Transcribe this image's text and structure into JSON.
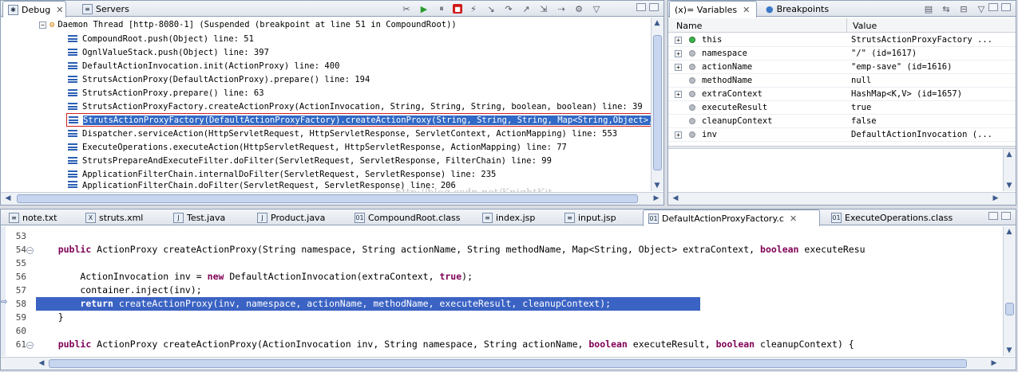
{
  "debug_panel": {
    "tabs": [
      {
        "label": "Debug",
        "active": true
      },
      {
        "label": "Servers",
        "active": false
      }
    ],
    "thread": "Daemon Thread [http-8080-1] (Suspended (breakpoint at line 51 in CompoundRoot))",
    "frames": [
      "CompoundRoot.push(Object) line: 51",
      "OgnlValueStack.push(Object) line: 397",
      "DefaultActionInvocation.init(ActionProxy) line: 400",
      "StrutsActionProxy(DefaultActionProxy).prepare() line: 194",
      "StrutsActionProxy.prepare() line: 63",
      "StrutsActionProxyFactory.createActionProxy(ActionInvocation, String, String, String, boolean, boolean) line: 39",
      "StrutsActionProxyFactory(DefaultActionProxyFactory).createActionProxy(String, String, String, Map<String,Object>, bool",
      "Dispatcher.serviceAction(HttpServletRequest, HttpServletResponse, ServletContext, ActionMapping) line: 553",
      "ExecuteOperations.executeAction(HttpServletRequest, HttpServletResponse, ActionMapping) line: 77",
      "StrutsPrepareAndExecuteFilter.doFilter(ServletRequest, ServletResponse, FilterChain) line: 99",
      "ApplicationFilterChain.internalDoFilter(ServletRequest, ServletResponse) line: 235",
      "ApplicationFilterChain.doFilter(ServletRequest, ServletResponse) line: 206"
    ],
    "selected_frame_index": 6,
    "watermark": "http://blog.csdn.net/KnightKit"
  },
  "variables_panel": {
    "tabs": [
      {
        "label": "(x)= Variables",
        "active": true
      },
      {
        "label": "Breakpoints",
        "active": false
      }
    ],
    "columns": [
      "Name",
      "Value"
    ],
    "rows": [
      {
        "expand": "+",
        "dot": "green",
        "name": "this",
        "value": "StrutsActionProxyFactory  ..."
      },
      {
        "expand": "+",
        "dot": "grey",
        "name": "namespace",
        "value": "\"/\" (id=1617)"
      },
      {
        "expand": "+",
        "dot": "grey",
        "name": "actionName",
        "value": "\"emp-save\" (id=1616)"
      },
      {
        "expand": "",
        "dot": "grey",
        "name": "methodName",
        "value": "null"
      },
      {
        "expand": "+",
        "dot": "grey",
        "name": "extraContext",
        "value": "HashMap<K,V>  (id=1657)"
      },
      {
        "expand": "",
        "dot": "grey",
        "name": "executeResult",
        "value": "true"
      },
      {
        "expand": "",
        "dot": "grey",
        "name": "cleanupContext",
        "value": "false"
      },
      {
        "expand": "+",
        "dot": "grey",
        "name": "inv",
        "value": "DefaultActionInvocation  (..."
      }
    ]
  },
  "editor": {
    "tabs": [
      {
        "label": "note.txt",
        "icon": "txt",
        "active": false
      },
      {
        "label": "struts.xml",
        "icon": "X",
        "active": false
      },
      {
        "label": "Test.java",
        "icon": "J",
        "active": false
      },
      {
        "label": "Product.java",
        "icon": "J",
        "active": false
      },
      {
        "label": "CompoundRoot.class",
        "icon": "010",
        "active": false
      },
      {
        "label": "index.jsp",
        "icon": "jsp",
        "active": false
      },
      {
        "label": "input.jsp",
        "icon": "jsp",
        "active": false
      },
      {
        "label": "DefaultActionProxyFactory.c",
        "icon": "010",
        "active": true
      },
      {
        "label": "ExecuteOperations.class",
        "icon": "010",
        "active": false
      }
    ],
    "lines": [
      {
        "num": "53",
        "code": ""
      },
      {
        "num": "54",
        "code": "    public ActionProxy createActionProxy(String namespace, String actionName, String methodName, Map<String, Object> extraContext, boolean executeResu",
        "kw": [
          "public",
          "boolean"
        ]
      },
      {
        "num": "55",
        "code": ""
      },
      {
        "num": "56",
        "code": "        ActionInvocation inv = new DefaultActionInvocation(extraContext, true);",
        "kw": [
          "new",
          "true"
        ]
      },
      {
        "num": "57",
        "code": "        container.inject(inv);"
      },
      {
        "num": "58",
        "code": "        return createActionProxy(inv, namespace, actionName, methodName, executeResult, cleanupContext);",
        "highlight": true
      },
      {
        "num": "59",
        "code": "    }"
      },
      {
        "num": "60",
        "code": ""
      },
      {
        "num": "61",
        "code": "    public ActionProxy createActionProxy(ActionInvocation inv, String namespace, String actionName, boolean executeResult, boolean cleanupContext) {",
        "kw": [
          "public",
          "boolean"
        ]
      }
    ]
  }
}
